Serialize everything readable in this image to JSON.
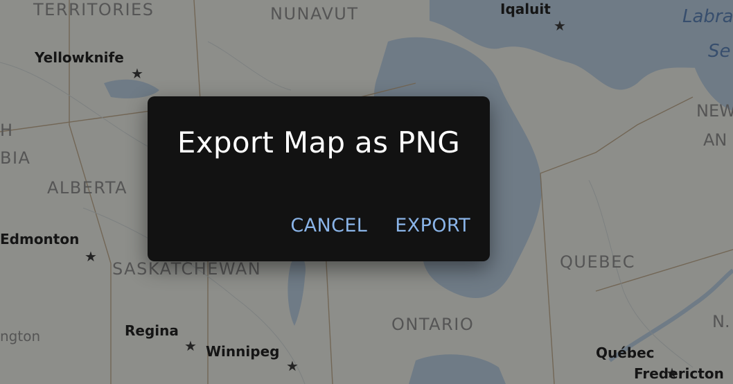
{
  "map": {
    "labels": {
      "territories": "TERRITORIES",
      "nunavut": "NUNAVUT",
      "iqaluit": "Iqaluit",
      "labrador": "Labra",
      "sea": "Se",
      "yellowknife": "Yellowknife",
      "british_h": "H",
      "british_bia": "BIA",
      "alberta": "ALBERTA",
      "new1": "NEW",
      "new2": "AN",
      "edmonton": "Edmonton",
      "saskatchewan": "SASKATCHEWAN",
      "quebec_prov": "QUEBEC",
      "regina": "Regina",
      "ontario": "ONTARIO",
      "ns": "N.",
      "washington": "ngton",
      "winnipeg": "Winnipeg",
      "quebec_city": "Québec",
      "fredericton": "Fredericton"
    }
  },
  "dialog": {
    "title": "Export Map as PNG",
    "cancel_label": "CANCEL",
    "export_label": "EXPORT"
  }
}
